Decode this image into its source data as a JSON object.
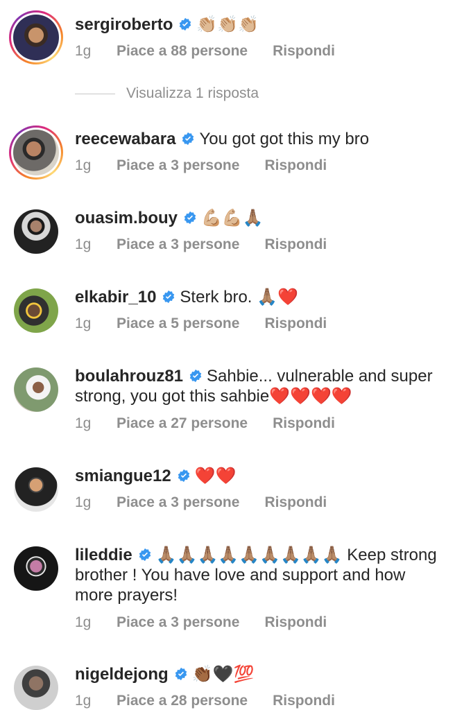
{
  "comments": [
    {
      "username": "sergiroberto",
      "text": "👏🏼👏🏼👏🏼",
      "time": "1g",
      "likes": "Piace a 88 persone",
      "reply": "Rispondi",
      "avatar_icon": "user-photo",
      "story_ring": true
    },
    {
      "username": "reecewabara",
      "text": "You got got this my bro",
      "time": "1g",
      "likes": "Piace a 3 persone",
      "reply": "Rispondi",
      "avatar_icon": "user-photo",
      "story_ring": true
    },
    {
      "username": "ouasim.bouy",
      "text": "💪🏼💪🏼🙏🏽",
      "time": "1g",
      "likes": "Piace a 3 persone",
      "reply": "Rispondi",
      "avatar_icon": "user-photo",
      "story_ring": false
    },
    {
      "username": "elkabir_10",
      "text": "Sterk bro. 🙏🏽❤️",
      "time": "1g",
      "likes": "Piace a 5 persone",
      "reply": "Rispondi",
      "avatar_icon": "user-photo",
      "story_ring": false
    },
    {
      "username": "boulahrouz81",
      "text": "Sahbie... vulnerable and super strong, you  got this sahbie❤️❤️❤️❤️",
      "time": "1g",
      "likes": "Piace a 27 persone",
      "reply": "Rispondi",
      "avatar_icon": "user-photo",
      "story_ring": false
    },
    {
      "username": "smiangue12",
      "text": "❤️❤️",
      "time": "1g",
      "likes": "Piace a 3 persone",
      "reply": "Rispondi",
      "avatar_icon": "user-photo",
      "story_ring": false
    },
    {
      "username": "lileddie",
      "text": "🙏🏽🙏🏽🙏🏽🙏🏽🙏🏽🙏🏽🙏🏽🙏🏽🙏🏽 Keep strong brother ! You have love and support and how more prayers!",
      "time": "1g",
      "likes": "Piace a 3 persone",
      "reply": "Rispondi",
      "avatar_icon": "user-photo",
      "story_ring": false
    },
    {
      "username": "nigeldejong",
      "text": "👏🏾🖤💯",
      "time": "1g",
      "likes": "Piace a 28 persone",
      "reply": "Rispondi",
      "avatar_icon": "user-photo",
      "story_ring": false
    }
  ],
  "view_replies": "Visualizza 1 risposta",
  "colors": {
    "text": "#262626",
    "secondary": "#8e8e8e",
    "verified_blue": "#3897f0",
    "background": "#ffffff"
  },
  "icons": {
    "verified": "verified-badge-icon"
  }
}
